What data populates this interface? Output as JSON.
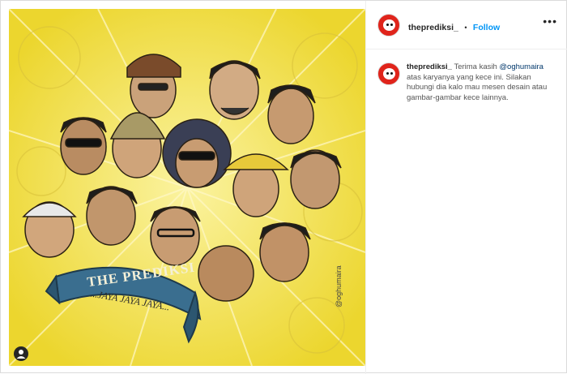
{
  "header": {
    "username": "theprediksi_",
    "separator": "•",
    "follow_label": "Follow",
    "more_icon": "more-horizontal-icon"
  },
  "caption": {
    "username": "theprediksi_",
    "text_1": "Terima kasih",
    "mention": "@oghumaira",
    "text_2": "atas karyanya yang kece ini. Silakan hubungi dia kalo mau mesen desain atau gambar-gambar kece lainnya."
  },
  "image": {
    "banner_title": "THE PREDIKSI",
    "banner_subtitle": "...JAYA JAYA JAYA...",
    "artist_signature": "@oghumaira",
    "user_tag_icon": "user-tag-icon"
  },
  "colors": {
    "background_yellow": "#f2e24a",
    "banner_blue": "#3a6e8f",
    "accent_link": "#0095f6",
    "avatar_red": "#e0241b"
  }
}
